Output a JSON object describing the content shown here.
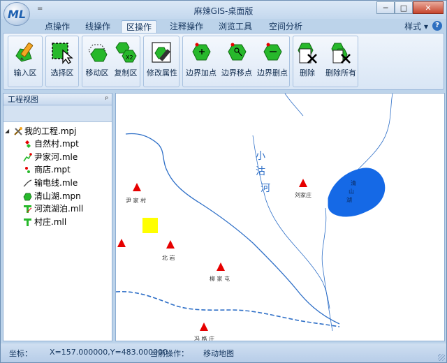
{
  "window": {
    "title": "麻辣GIS-桌面版"
  },
  "app_logo": {
    "text": "ML"
  },
  "quick_access": {
    "label": "="
  },
  "window_buttons": {
    "minimize": "─",
    "maximize": "□",
    "close": "✕"
  },
  "ribbon_tabs": [
    {
      "label": "点操作",
      "active": false
    },
    {
      "label": "线操作",
      "active": false
    },
    {
      "label": "区操作",
      "active": true
    },
    {
      "label": "注释操作",
      "active": false
    },
    {
      "label": "浏览工具",
      "active": false
    },
    {
      "label": "空间分析",
      "active": false
    }
  ],
  "style_menu": {
    "label": "样式",
    "arrow": "▾"
  },
  "help": {
    "label": "?"
  },
  "ribbon_buttons": {
    "input_area": "输入区",
    "select_area": "选择区",
    "move_area": "移动区",
    "copy_area": "复制区",
    "copy_badge": "X2",
    "modify_props": "修改属性",
    "boundary_add": "边界加点",
    "boundary_move": "边界移点",
    "boundary_delete": "边界删点",
    "delete": "删除",
    "delete_all": "删除所有"
  },
  "project_panel": {
    "title": "工程视图",
    "pin": "ᵖ",
    "root": "我的工程.mpj",
    "expander": "◢",
    "items": [
      {
        "label": "自然村.mpt",
        "icon": "point-layer-icon"
      },
      {
        "label": "尹家河.mle",
        "icon": "line-layer-icon"
      },
      {
        "label": "商店.mpt",
        "icon": "point-layer-icon"
      },
      {
        "label": "输电线.mle",
        "icon": "line-layer-icon"
      },
      {
        "label": "清山湖.mpn",
        "icon": "polygon-layer-icon"
      },
      {
        "label": "河流湖泊.mll",
        "icon": "label-layer-icon"
      },
      {
        "label": "村庄.mll",
        "icon": "label-layer-icon"
      }
    ]
  },
  "map": {
    "river_label": [
      "小",
      "沽",
      "河"
    ],
    "lake_label": [
      "清",
      "山",
      "湖"
    ],
    "villages": [
      "尹 家 村",
      "刘家庄",
      "北 岩",
      "柳 家 屯",
      "冯 格 庄"
    ],
    "colors": {
      "river": "#2e6fc7",
      "lake": "#1569e6",
      "marker": "#e60000",
      "shop": "#ffff00"
    }
  },
  "status_bar": {
    "coord_label": "坐标：",
    "coord_value": "X=157.000000,Y=483.000000",
    "operation_label": "当前操作：",
    "operation_value": "移动地图"
  }
}
